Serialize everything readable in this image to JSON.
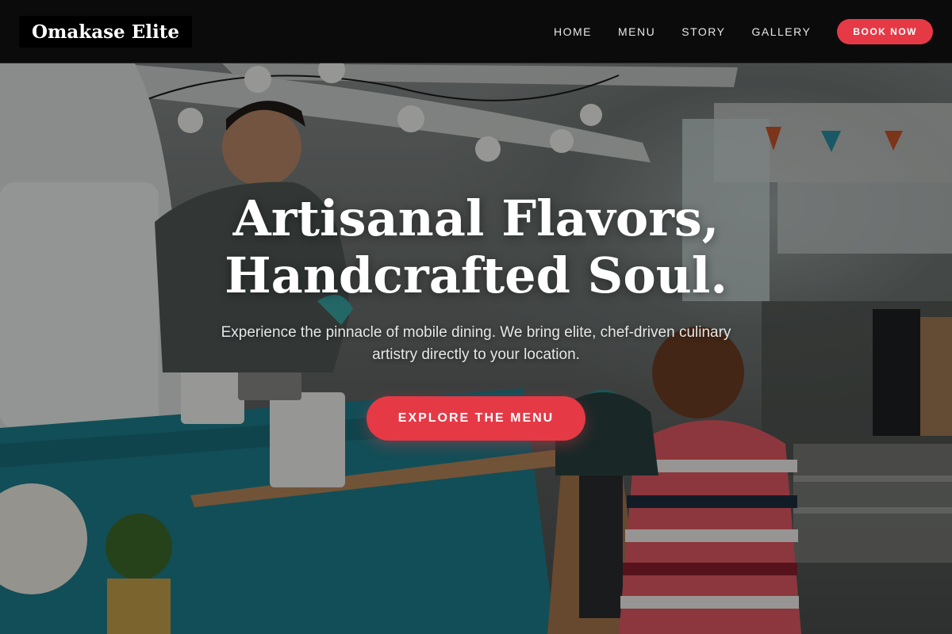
{
  "brand": {
    "name": "Omakase Elite"
  },
  "nav": {
    "links": [
      "HOME",
      "MENU",
      "STORY",
      "GALLERY"
    ],
    "cta_label": "BOOK NOW"
  },
  "hero": {
    "headline_line1": "Artisanal Flavors,",
    "headline_line2": "Handcrafted Soul.",
    "subtext": "Experience the pinnacle of mobile dining. We bring elite, chef-driven culinary artistry directly to your location.",
    "cta_label": "EXPLORE THE MENU",
    "background_image": "food-truck-scene"
  },
  "colors": {
    "accent": "#e53946",
    "navbar_bg": "#0b0b0b",
    "text": "#ffffff"
  }
}
